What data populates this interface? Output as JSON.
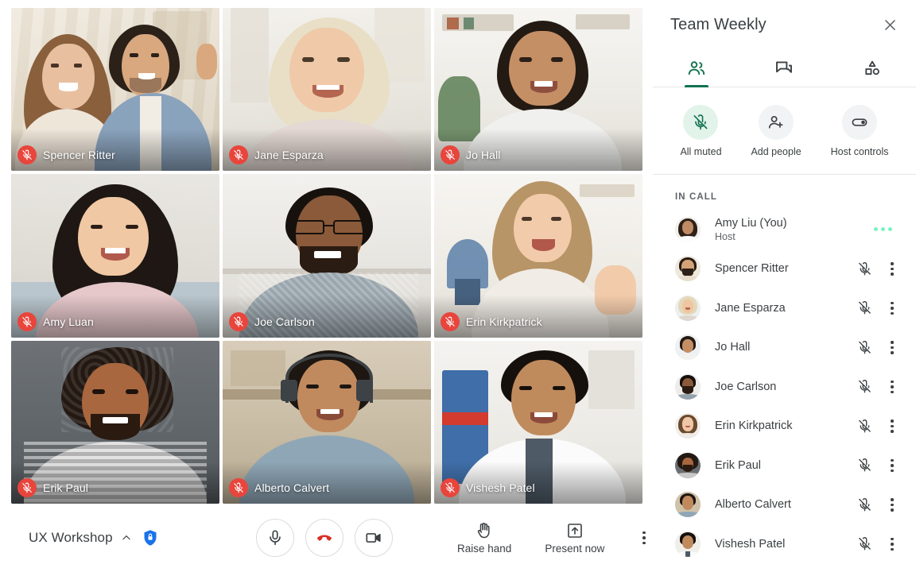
{
  "panel": {
    "title": "Team Weekly",
    "close_icon": "close-icon",
    "tabs": [
      {
        "id": "people",
        "icon": "people-icon",
        "active": true
      },
      {
        "id": "chat",
        "icon": "chat-icon",
        "active": false
      },
      {
        "id": "activities",
        "icon": "activities-shapes-icon",
        "active": false
      }
    ],
    "quick_actions": [
      {
        "id": "all-muted",
        "label": "All muted",
        "icon": "mic-off-icon",
        "highlight": true
      },
      {
        "id": "add-people",
        "label": "Add people",
        "icon": "person-add-icon",
        "highlight": false
      },
      {
        "id": "host-controls",
        "label": "Host controls",
        "icon": "toggle-icon",
        "highlight": false
      }
    ],
    "section_label": "IN CALL",
    "participants": [
      {
        "name": "Amy Liu (You)",
        "sub": "Host",
        "muted": false,
        "speaking": true,
        "menu": false
      },
      {
        "name": "Spencer Ritter",
        "sub": "",
        "muted": true,
        "speaking": false,
        "menu": true
      },
      {
        "name": "Jane Esparza",
        "sub": "",
        "muted": true,
        "speaking": false,
        "menu": true
      },
      {
        "name": "Jo Hall",
        "sub": "",
        "muted": true,
        "speaking": false,
        "menu": true
      },
      {
        "name": "Joe Carlson",
        "sub": "",
        "muted": true,
        "speaking": false,
        "menu": true
      },
      {
        "name": "Erin Kirkpatrick",
        "sub": "",
        "muted": true,
        "speaking": false,
        "menu": true
      },
      {
        "name": "Erik Paul",
        "sub": "",
        "muted": true,
        "speaking": false,
        "menu": true
      },
      {
        "name": "Alberto Calvert",
        "sub": "",
        "muted": true,
        "speaking": false,
        "menu": true
      },
      {
        "name": "Vishesh Patel",
        "sub": "",
        "muted": true,
        "speaking": false,
        "menu": true
      }
    ]
  },
  "stage": {
    "tiles": [
      {
        "name": "Spencer Ritter",
        "muted": true
      },
      {
        "name": "Jane Esparza",
        "muted": true
      },
      {
        "name": "Jo Hall",
        "muted": true
      },
      {
        "name": "Amy Luan",
        "muted": true
      },
      {
        "name": "Joe Carlson",
        "muted": true
      },
      {
        "name": "Erin Kirkpatrick",
        "muted": true
      },
      {
        "name": "Erik Paul",
        "muted": true
      },
      {
        "name": "Alberto Calvert",
        "muted": true
      },
      {
        "name": "Vishesh Patel",
        "muted": true
      }
    ]
  },
  "bottom_bar": {
    "meeting_name": "UX Workshop",
    "caret_icon": "chevron-up-icon",
    "encryption_icon": "shield-lock-icon",
    "controls": [
      {
        "id": "mic",
        "icon": "mic-icon"
      },
      {
        "id": "end-call",
        "icon": "end-call-icon"
      },
      {
        "id": "camera",
        "icon": "camera-icon"
      }
    ],
    "raise_hand_label": "Raise hand",
    "raise_hand_icon": "raise-hand-icon",
    "present_now_label": "Present now",
    "present_now_icon": "present-now-icon",
    "more_icon": "more-vertical-icon"
  },
  "colors": {
    "accent_green": "#137350",
    "mint": "#e2f3ea",
    "speaking_dot": "#7bf3c2",
    "mute_red": "#e8453c",
    "end_call_red": "#d93025",
    "shield_blue": "#1a73e8",
    "text": "#3c4043",
    "subtext": "#5f6368"
  }
}
